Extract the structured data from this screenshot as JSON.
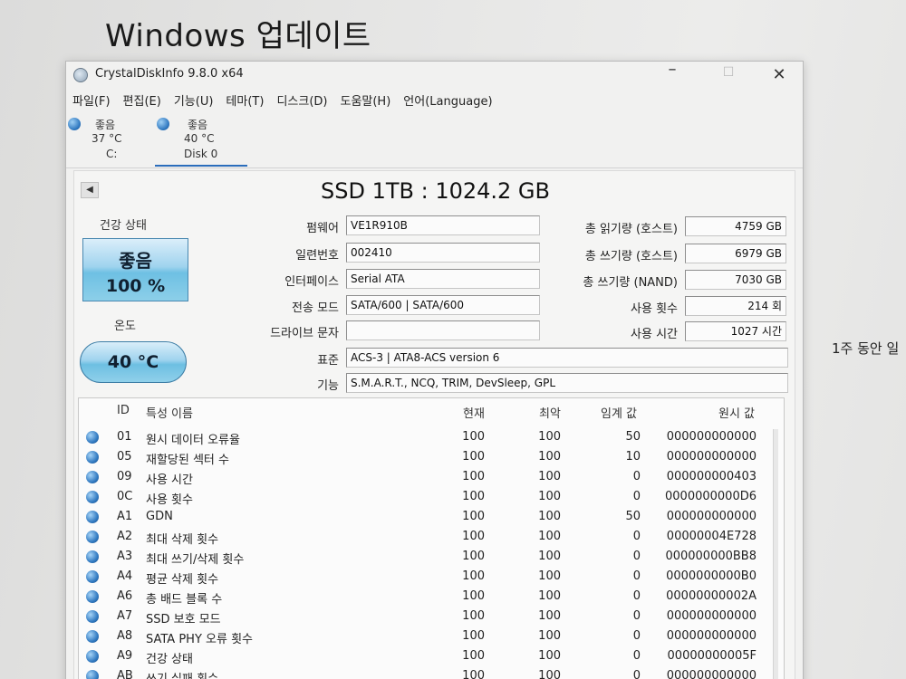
{
  "background": {
    "title": "Windows 업데이트",
    "side_text": "1주 동안 일"
  },
  "window": {
    "title": "CrystalDiskInfo 9.8.0 x64",
    "controls": {
      "minimize": "–",
      "maximize": "☐",
      "close": "✕"
    }
  },
  "menu": [
    "파일(F)",
    "편집(E)",
    "기능(U)",
    "테마(T)",
    "디스크(D)",
    "도움말(H)",
    "언어(Language)"
  ],
  "drives": [
    {
      "status": "좋음",
      "temp": "37 °C",
      "name": "C:"
    },
    {
      "status": "좋음",
      "temp": "40 °C",
      "name": "Disk 0"
    }
  ],
  "disk": {
    "title": "SSD 1TB : 1024.2 GB",
    "health_label": "건강 상태",
    "health_status": "좋음",
    "health_percent": "100 %",
    "temp_label": "온도",
    "temp_value": "40 °C",
    "fields_left": [
      {
        "label": "펌웨어",
        "value": "VE1R910B"
      },
      {
        "label": "일련번호",
        "value": "002410"
      },
      {
        "label": "인터페이스",
        "value": "Serial ATA"
      },
      {
        "label": "전송 모드",
        "value": "SATA/600 | SATA/600"
      },
      {
        "label": "드라이브 문자",
        "value": ""
      }
    ],
    "fields_right": [
      {
        "label": "총 읽기량 (호스트)",
        "value": "4759 GB"
      },
      {
        "label": "총 쓰기량 (호스트)",
        "value": "6979 GB"
      },
      {
        "label": "총 쓰기량 (NAND)",
        "value": "7030 GB"
      },
      {
        "label": "사용 횟수",
        "value": "214 회"
      },
      {
        "label": "사용 시간",
        "value": "1027 시간"
      }
    ],
    "standard_label": "표준",
    "standard_value": "ACS-3 | ATA8-ACS version 6",
    "features_label": "기능",
    "features_value": "S.M.A.R.T., NCQ, TRIM, DevSleep, GPL"
  },
  "smart": {
    "headers": {
      "id": "ID",
      "name": "특성 이름",
      "current": "현재",
      "worst": "최악",
      "threshold": "임계 값",
      "raw": "원시 값"
    },
    "rows": [
      {
        "id": "01",
        "name": "원시 데이터 오류율",
        "current": "100",
        "worst": "100",
        "threshold": "50",
        "raw": "000000000000"
      },
      {
        "id": "05",
        "name": "재할당된 섹터 수",
        "current": "100",
        "worst": "100",
        "threshold": "10",
        "raw": "000000000000"
      },
      {
        "id": "09",
        "name": "사용 시간",
        "current": "100",
        "worst": "100",
        "threshold": "0",
        "raw": "000000000403"
      },
      {
        "id": "0C",
        "name": "사용 횟수",
        "current": "100",
        "worst": "100",
        "threshold": "0",
        "raw": "0000000000D6"
      },
      {
        "id": "A1",
        "name": "GDN",
        "current": "100",
        "worst": "100",
        "threshold": "50",
        "raw": "000000000000"
      },
      {
        "id": "A2",
        "name": "최대 삭제 횟수",
        "current": "100",
        "worst": "100",
        "threshold": "0",
        "raw": "00000004E728"
      },
      {
        "id": "A3",
        "name": "최대 쓰기/삭제 횟수",
        "current": "100",
        "worst": "100",
        "threshold": "0",
        "raw": "000000000BB8"
      },
      {
        "id": "A4",
        "name": "평균 삭제 횟수",
        "current": "100",
        "worst": "100",
        "threshold": "0",
        "raw": "0000000000B0"
      },
      {
        "id": "A6",
        "name": "총 배드 블록 수",
        "current": "100",
        "worst": "100",
        "threshold": "0",
        "raw": "00000000002A"
      },
      {
        "id": "A7",
        "name": "SSD 보호 모드",
        "current": "100",
        "worst": "100",
        "threshold": "0",
        "raw": "000000000000"
      },
      {
        "id": "A8",
        "name": "SATA PHY 오류 횟수",
        "current": "100",
        "worst": "100",
        "threshold": "0",
        "raw": "000000000000"
      },
      {
        "id": "A9",
        "name": "건강 상태",
        "current": "100",
        "worst": "100",
        "threshold": "0",
        "raw": "00000000005F"
      },
      {
        "id": "AB",
        "name": "쓰기 실패 횟수",
        "current": "100",
        "worst": "100",
        "threshold": "0",
        "raw": "000000000000"
      }
    ]
  },
  "colors": {
    "accent": "#2b6dbb",
    "health_good": "#6ec0e3"
  },
  "icons": {
    "status_dot": "status-dot-icon",
    "nav": "left-arrow-icon",
    "app": "app-icon"
  }
}
